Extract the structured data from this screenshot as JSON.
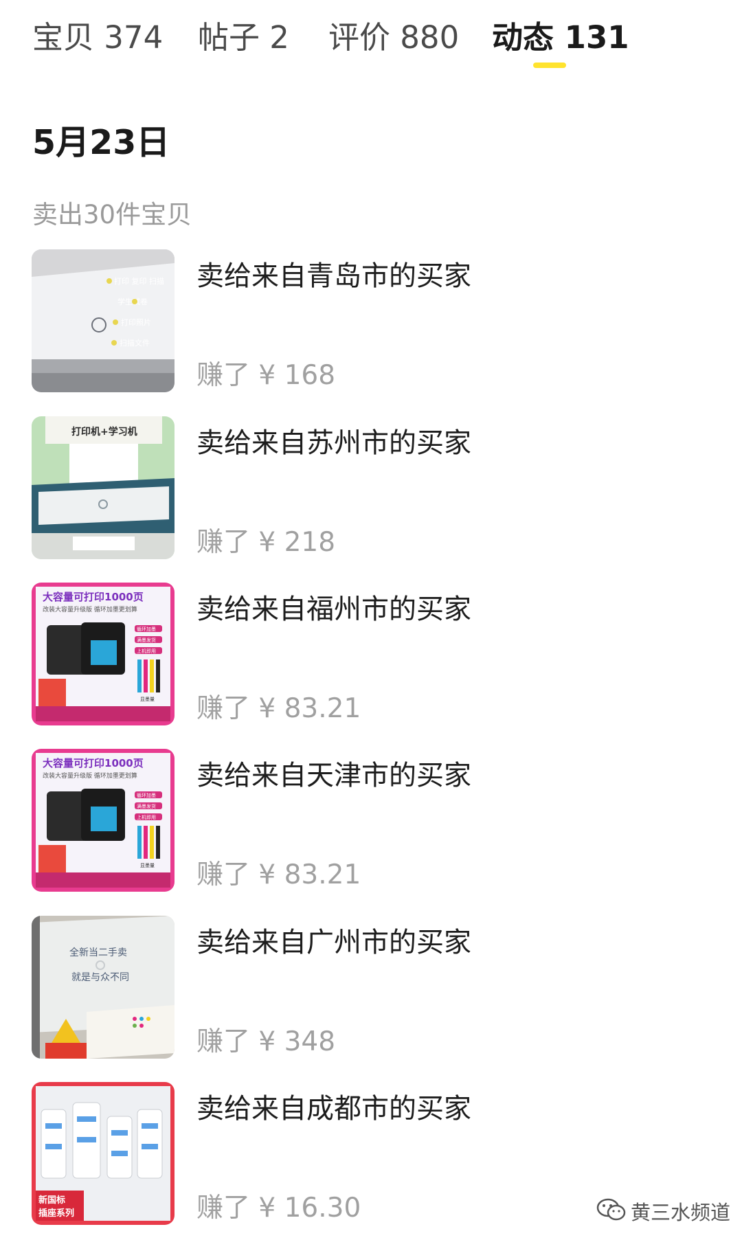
{
  "tabs": [
    {
      "label": "宝贝 374",
      "active": false
    },
    {
      "label": "帖子 2",
      "active": false
    },
    {
      "label": "评价 880",
      "active": false
    },
    {
      "label": "动态 131",
      "active": true
    }
  ],
  "accent_color": "#ffe32e",
  "date": "5月23日",
  "summary": "卖出30件宝贝",
  "sales": [
    {
      "buyer": "卖给来自青岛市的买家",
      "earned": "赚了 ¥ 168",
      "thumb_texts": [
        "打印 复印 扫描",
        "学生试卷",
        "打印照片",
        "扫描文件"
      ]
    },
    {
      "buyer": "卖给来自苏州市的买家",
      "earned": "赚了 ¥ 218",
      "thumb_texts": [
        "打印机+学习机"
      ]
    },
    {
      "buyer": "卖给来自福州市的买家",
      "earned": "赚了 ¥ 83.21",
      "thumb_texts": [
        "大容量可打印1000页",
        "改装大容量升级版 循环加墨更划算",
        "循环加墨",
        "满墨发货",
        "上机即用",
        "显墨量"
      ]
    },
    {
      "buyer": "卖给来自天津市的买家",
      "earned": "赚了 ¥ 83.21",
      "thumb_texts": [
        "大容量可打印1000页",
        "改装大容量升级版 循环加墨更划算",
        "循环加墨",
        "满墨发货",
        "上机即用",
        "显墨量"
      ]
    },
    {
      "buyer": "卖给来自广州市的买家",
      "earned": "赚了 ¥ 348",
      "thumb_texts": [
        "全新当二手卖",
        "就是与众不同"
      ]
    },
    {
      "buyer": "卖给来自成都市的买家",
      "earned": "赚了 ¥ 16.30",
      "thumb_texts": [
        "新国标",
        "插座系列"
      ]
    }
  ],
  "watermark": {
    "icon": "wechat-icon",
    "text": "黄三水频道"
  }
}
